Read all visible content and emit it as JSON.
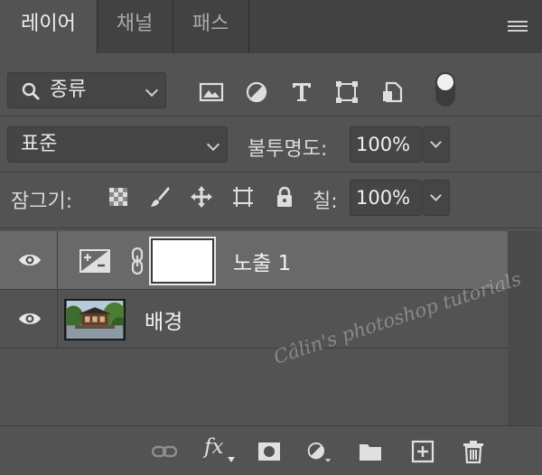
{
  "tabs": [
    {
      "label": "레이어",
      "active": true
    },
    {
      "label": "채널",
      "active": false
    },
    {
      "label": "패스",
      "active": false
    }
  ],
  "filter": {
    "kind_label": "종류",
    "buttons": [
      "image-filter-icon",
      "adjustment-filter-icon",
      "type-filter-icon",
      "shape-filter-icon",
      "smart-object-filter-icon"
    ]
  },
  "blend": {
    "mode": "표준",
    "opacity_label": "불투명도:",
    "opacity_value": "100%"
  },
  "lock": {
    "label": "잠그기:",
    "fill_label": "칠:",
    "fill_value": "100%"
  },
  "layers": [
    {
      "name": "노출 1",
      "type": "adjustment",
      "visible": true,
      "selected": true
    },
    {
      "name": "배경",
      "type": "image",
      "visible": true,
      "selected": false
    }
  ],
  "bottom_icons": [
    "link-layers-icon",
    "fx-icon",
    "add-mask-icon",
    "new-adjustment-icon",
    "new-group-icon",
    "new-layer-icon",
    "delete-layer-icon"
  ],
  "bottom_fx_label": "fx",
  "watermark": "Câlin's photoshop tutorials",
  "colors": {
    "panel": "#535353",
    "tabbar": "#424242",
    "selected_layer": "#696969"
  }
}
